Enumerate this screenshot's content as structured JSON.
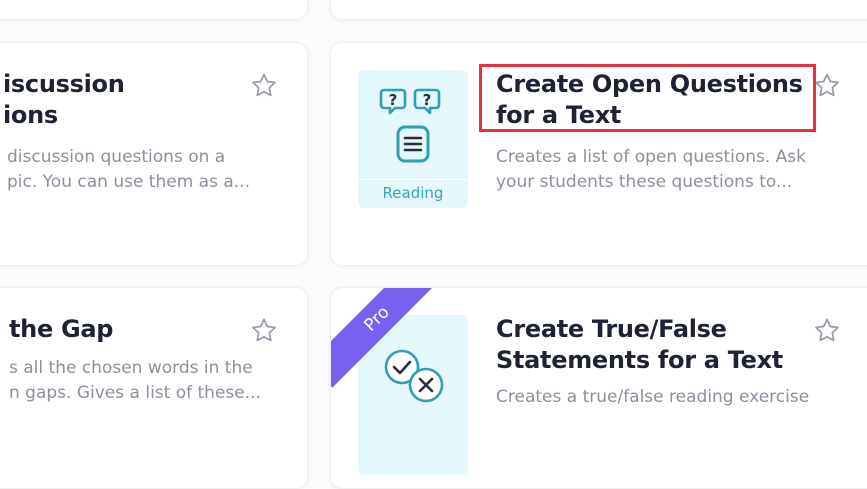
{
  "cards": {
    "discussion": {
      "title_line1": "iscussion",
      "title_line2": "ions",
      "desc_line1": "discussion questions on a",
      "desc_line2": "pic. You can use them as a..."
    },
    "open_questions": {
      "title_line1": "Create Open Questions",
      "title_line2": "for a Text",
      "desc_line1": "Creates a list of open questions. Ask",
      "desc_line2": "your students these questions to...",
      "tag": "Reading"
    },
    "gap": {
      "title_line1": "the Gap",
      "desc_line1": "s all the chosen words in the",
      "desc_line2": "n gaps. Gives a list of these..."
    },
    "true_false": {
      "ribbon": "Pro",
      "title_line1": "Create True/False",
      "title_line2": "Statements for a Text",
      "desc_line1": "Creates a true/false reading exercise"
    }
  },
  "icons": [
    "star-icon",
    "question-bubbles-icon",
    "document-icon",
    "check-icon",
    "x-icon"
  ],
  "colors": {
    "accent": "#7a60f0",
    "highlight": "#e8303f",
    "thumb_bg": "#e4f7fb",
    "icon": "#2f9fb5"
  }
}
